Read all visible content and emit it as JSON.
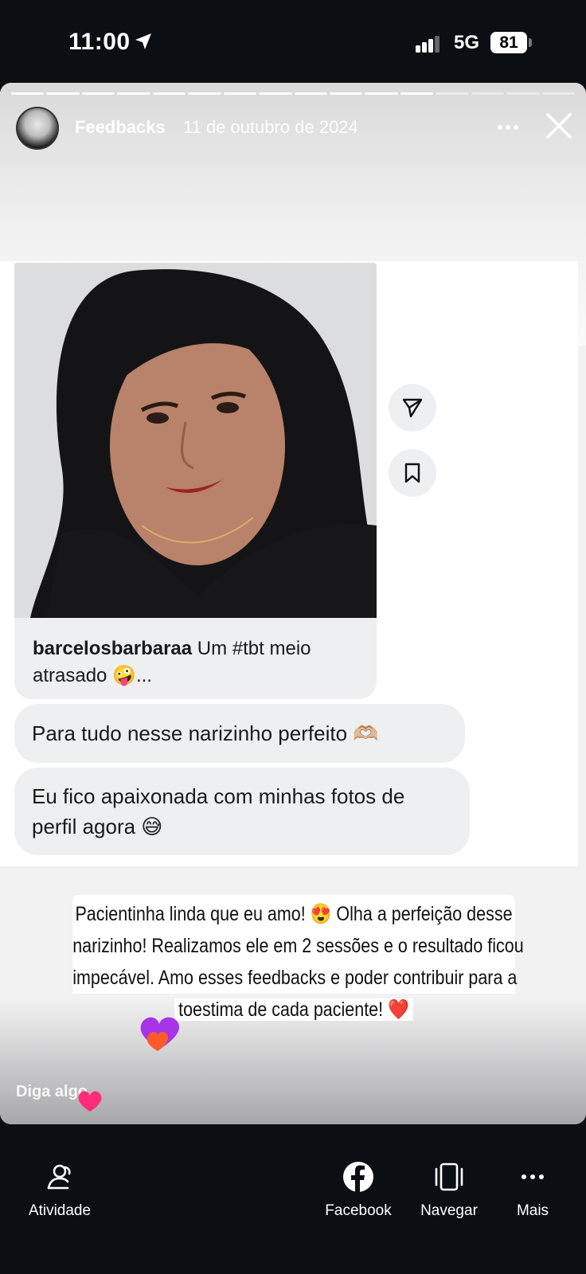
{
  "status_bar": {
    "time": "11:00",
    "network": "5G",
    "battery": "81"
  },
  "story": {
    "username": "Feedbacks",
    "date": "11 de outubro de 2024",
    "progress_segments_total": 16,
    "progress_segments_viewed": 12,
    "reply_placeholder": "Diga algo",
    "text_lines": [
      "Pacientinha linda que eu amo! 😍 Olha a perfeição desse",
      "narizinho! Realizamos ele em 2 sessões e o resultado ficou",
      "impecável. Amo esses feedbacks e poder contribuir para a",
      "toestima de cada paciente! ❤️"
    ]
  },
  "dm": {
    "post": {
      "author": "barcelosbarbaraa",
      "caption": "Um  #tbt meio atrasado 🤪..."
    },
    "messages": [
      "Para tudo nesse narizinho perfeito 🫶🏼",
      "Eu fico apaixonada com minhas  fotos de perfil agora 😅"
    ]
  },
  "bottom_nav": {
    "items": [
      {
        "label": "Atividade",
        "icon": "activity-icon"
      },
      {
        "label": "Facebook",
        "icon": "facebook-icon"
      },
      {
        "label": "Navegar",
        "icon": "browse-icon"
      },
      {
        "label": "Mais",
        "icon": "more-icon"
      }
    ]
  },
  "colors": {
    "background": "#0b0f14",
    "bubble": "#eeeff1",
    "heart_pink": "#ff2d78",
    "heart_purple": "#a635e8"
  }
}
